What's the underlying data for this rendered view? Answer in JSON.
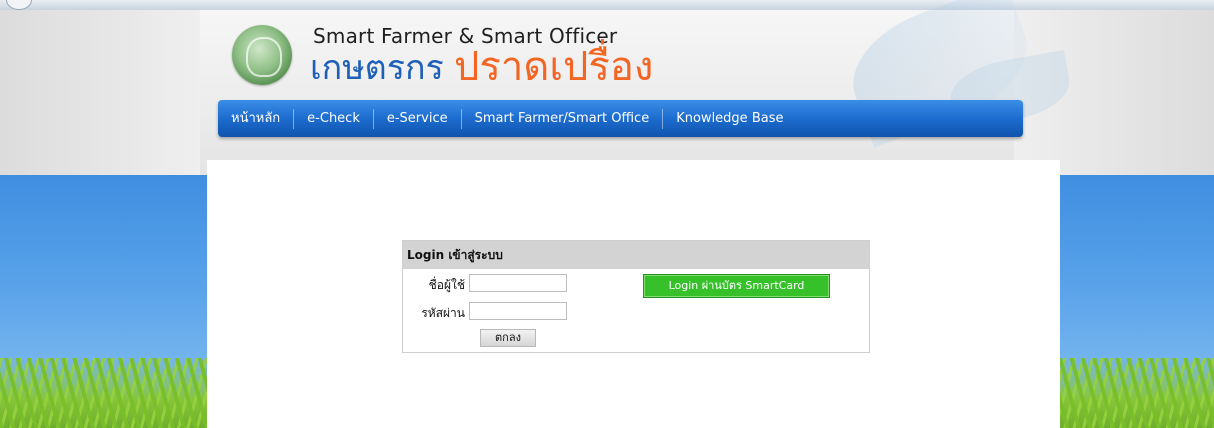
{
  "header": {
    "logo_en": "Smart Farmer & Smart Officer",
    "logo_th_part1": "เกษตรกร",
    "logo_th_part2": "ปราดเปรื่อง"
  },
  "nav": {
    "items": [
      {
        "label": "หน้าหลัก"
      },
      {
        "label": "e-Check"
      },
      {
        "label": "e-Service"
      },
      {
        "label": "Smart Farmer/Smart Office"
      },
      {
        "label": "Knowledge Base"
      }
    ]
  },
  "login": {
    "title": "Login เข้าสู่ระบบ",
    "username_label": "ชื่อผู้ใช้",
    "username_value": "",
    "password_label": "รหัสผ่าน",
    "password_value": "",
    "submit_label": "ตกลง",
    "smartcard_label": "Login ผ่านบัตร SmartCard"
  },
  "colors": {
    "nav_blue": "#1d6ccf",
    "logo_blue": "#1e60b8",
    "logo_orange": "#f26522",
    "smartcard_green": "#36c02a",
    "sky_blue": "#4a97e4"
  }
}
